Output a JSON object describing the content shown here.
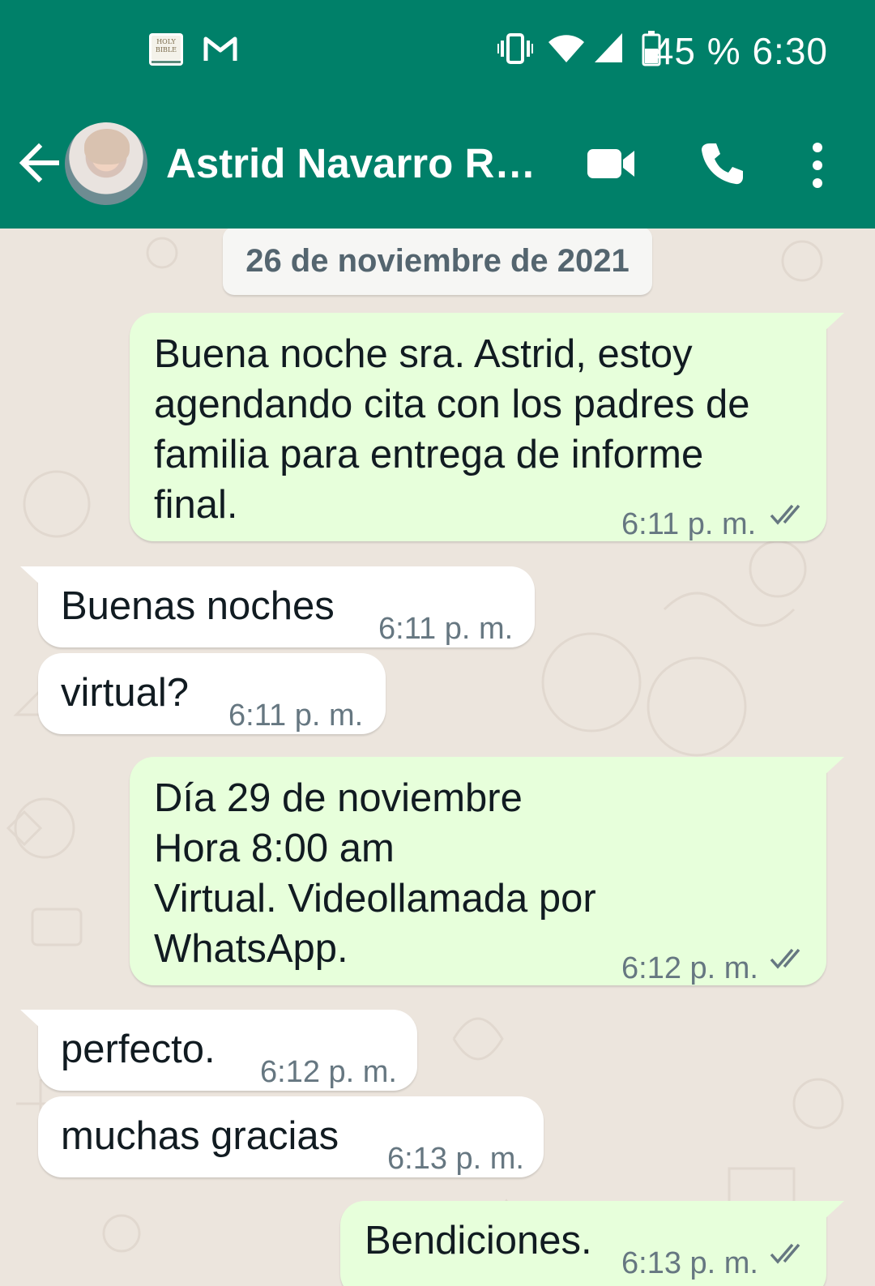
{
  "status_bar": {
    "battery_and_time": "45 % 6:30",
    "notification_icons": [
      "holy-bible-app-icon",
      "gmail-icon"
    ],
    "status_icons": [
      "vibrate-icon",
      "wifi-icon",
      "cellular-signal-icon",
      "battery-icon"
    ]
  },
  "header": {
    "contact_name": "Astrid Navarro Rod…",
    "actions": [
      "back-arrow-icon",
      "video-call-icon",
      "voice-call-icon",
      "more-options-icon"
    ]
  },
  "conversation": {
    "date_chip": "26 de noviembre de 2021",
    "messages": [
      {
        "direction": "outgoing",
        "text": "Buena noche sra. Astrid, estoy\nagendando cita con los padres de\nfamilia  para entrega de informe\nfinal.",
        "time": "6:11 p. m.",
        "status": "read"
      },
      {
        "direction": "incoming",
        "text": "Buenas noches",
        "time": "6:11 p. m."
      },
      {
        "direction": "incoming",
        "text": "virtual?",
        "time": "6:11 p. m."
      },
      {
        "direction": "outgoing",
        "text": "Día 29 de noviembre\nHora 8:00 am\nVirtual. Videollamada por\nWhatsApp.",
        "time": "6:12 p. m.",
        "status": "read"
      },
      {
        "direction": "incoming",
        "text": "perfecto.",
        "time": "6:12 p. m."
      },
      {
        "direction": "incoming",
        "text": "muchas gracias",
        "time": "6:13 p. m."
      },
      {
        "direction": "outgoing",
        "text": "Bendiciones.",
        "time": "6:13 p. m.",
        "status": "read"
      }
    ]
  },
  "colors": {
    "header_bg": "#008069",
    "chat_bg": "#ece5dd",
    "outgoing_bubble": "#e7ffdb",
    "incoming_bubble": "#ffffff",
    "timestamp": "#667781",
    "read_ticks": "#667781"
  }
}
